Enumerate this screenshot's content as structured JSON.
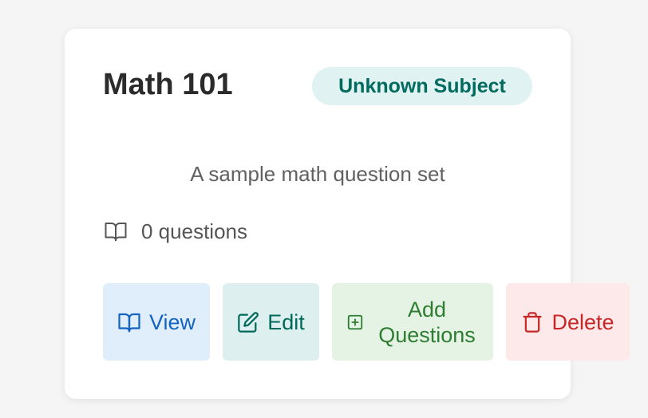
{
  "card": {
    "title": "Math 101",
    "subject_badge": "Unknown Subject",
    "description": "A sample math question set",
    "question_count_text": "0 questions"
  },
  "actions": {
    "view_label": "View",
    "edit_label": "Edit",
    "add_label": "Add Questions",
    "delete_label": "Delete"
  },
  "icons": {
    "count": "book-open-icon",
    "view": "book-open-icon",
    "edit": "edit-icon",
    "add": "plus-square-icon",
    "delete": "trash-icon"
  },
  "colors": {
    "badge_bg": "#e0f2f1",
    "badge_text": "#006b5e",
    "view_bg": "#e0eefc",
    "view_text": "#1565c0",
    "edit_bg": "#ddf0ef",
    "edit_text": "#00695c",
    "add_bg": "#e5f3e5",
    "add_text": "#2e7d32",
    "delete_bg": "#fde8ea",
    "delete_text": "#c62828"
  }
}
